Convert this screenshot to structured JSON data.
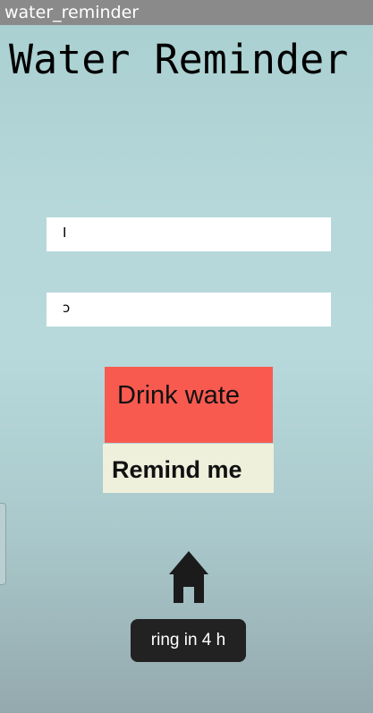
{
  "window": {
    "title": "water_reminder"
  },
  "app": {
    "title": "Water Reminder"
  },
  "fields": {
    "first_value": "I",
    "second_value": "ↄ"
  },
  "buttons": {
    "drink_label": "Drink wate",
    "remind_label": "Remind me"
  },
  "icons": {
    "home": "home-icon"
  },
  "toast": {
    "text": "ring in 4 h"
  },
  "colors": {
    "drink_button": "#f95a50",
    "remind_button": "#eef0dc",
    "toast_bg": "#222222",
    "titlebar": "#8a8a8a"
  }
}
